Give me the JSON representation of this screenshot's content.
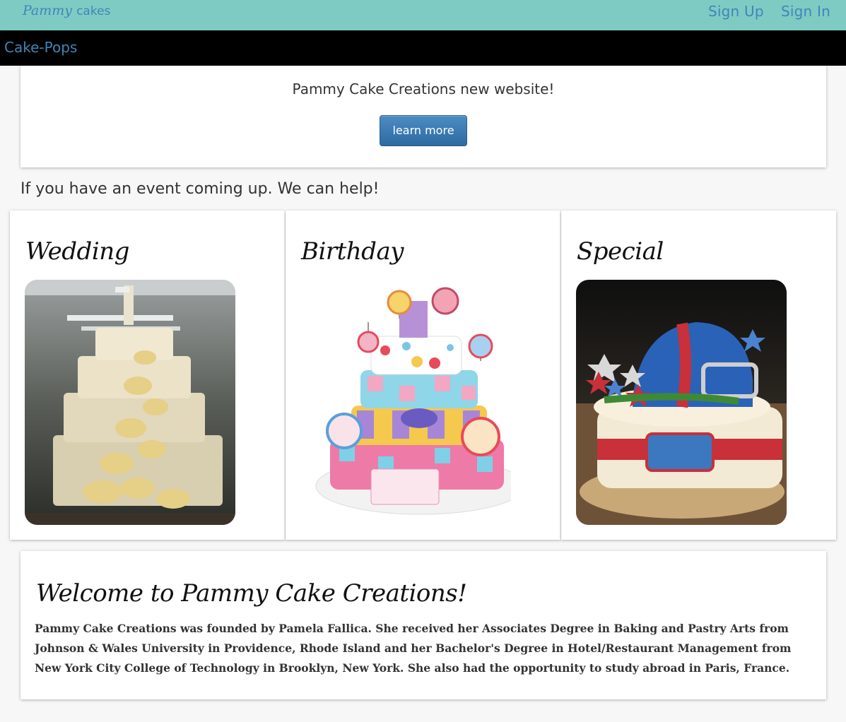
{
  "brand": {
    "script": "Pammy",
    "text": "cakes"
  },
  "nav": {
    "sign_up": "Sign Up",
    "sign_in": "Sign In"
  },
  "subnav": {
    "item": "Cake-Pops"
  },
  "hero": {
    "headline": "Pammy Cake Creations new website!",
    "button": "learn more"
  },
  "tagline": "If you have an event coming up. We can help!",
  "events": [
    {
      "title": "Wedding"
    },
    {
      "title": "Birthday"
    },
    {
      "title": "Special"
    }
  ],
  "welcome": {
    "title": "Welcome to Pammy Cake Creations!",
    "body": "Pammy Cake Creations was founded by Pamela Fallica. She received her Associates Degree in Baking and Pastry Arts from Johnson & Wales University in Providence, Rhode Island and her Bachelor's Degree in Hotel/Restaurant Management from New York City College of Technology in Brooklyn, New York. She also had the opportunity to study abroad in Paris, France."
  },
  "colors": {
    "topbar": "#7ecbc4",
    "link": "#3f86b8",
    "subnav": "#000000",
    "button": "#3a78b0"
  }
}
